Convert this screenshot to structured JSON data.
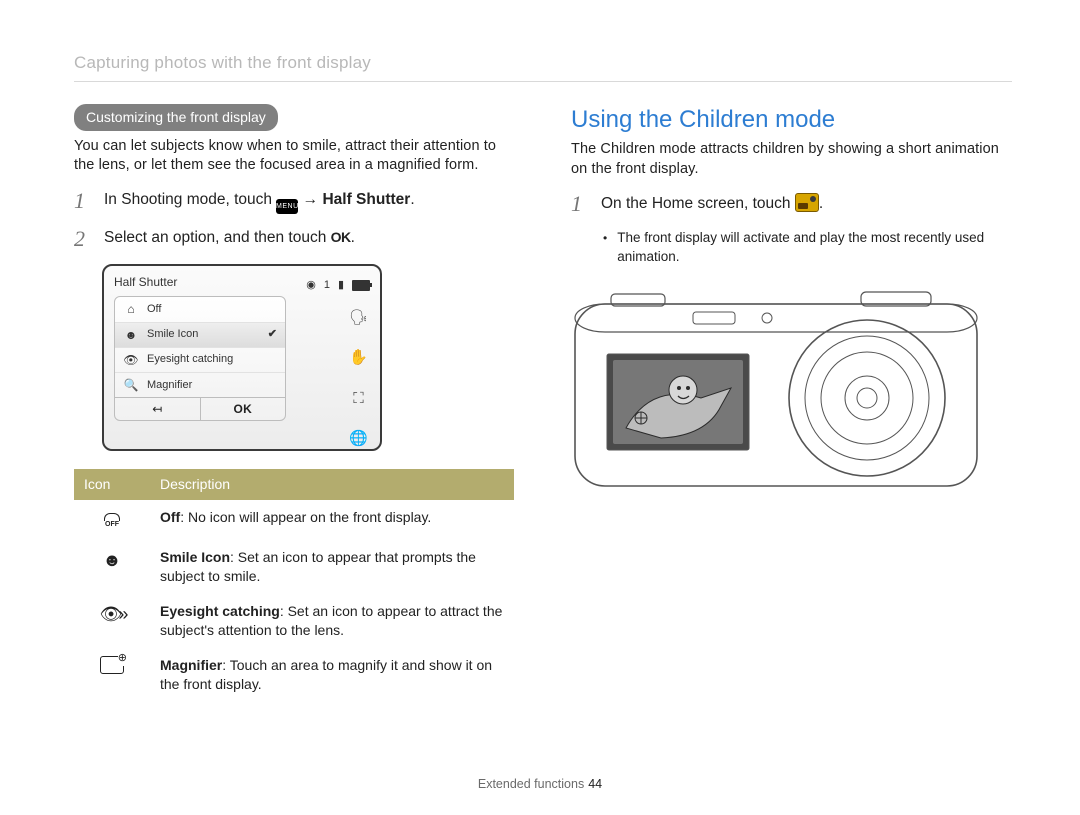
{
  "breadcrumb": "Capturing photos with the front display",
  "left": {
    "tag": "Customizing the front display",
    "intro": "You can let subjects know when to smile, attract their attention to the lens, or let them see the focused area in a magnified form.",
    "step1_pre": "In Shooting mode, touch ",
    "step1_arrow": " → ",
    "step1_target": "Half Shutter",
    "step2_pre": "Select an option, and then touch ",
    "ok_glyph": "OK",
    "menu_title": "Half Shutter",
    "status_number": "1",
    "menu_items": {
      "off": "Off",
      "smile": "Smile Icon",
      "eyesight": "Eyesight catching",
      "magnifier": "Magnifier"
    },
    "back_glyph": "↤",
    "ok_label": "OK",
    "table": {
      "h_icon": "Icon",
      "h_desc": "Description",
      "rows": {
        "off_b": "Off",
        "off_t": ": No icon will appear on the front display.",
        "smile_b": "Smile Icon",
        "smile_t": ": Set an icon to appear that prompts the subject to smile.",
        "eye_b": "Eyesight catching",
        "eye_t": ": Set an icon to appear to attract the subject's attention to the lens.",
        "mag_b": "Magnifier",
        "mag_t": ": Touch an area to magnify it and show it on the front display."
      }
    }
  },
  "right": {
    "heading": "Using the Children mode",
    "intro": "The Children mode attracts children by showing a short animation on the front display.",
    "step1_pre": "On the Home screen, touch ",
    "bullet": "The front display will activate and play the most recently used animation."
  },
  "footer": {
    "section": "Extended functions",
    "page": "44"
  }
}
